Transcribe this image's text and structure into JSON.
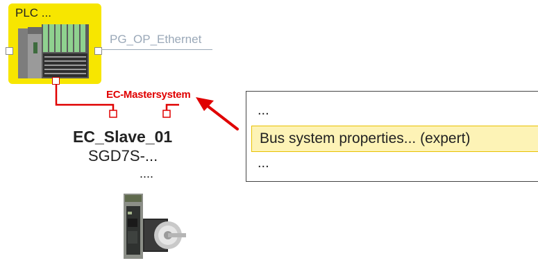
{
  "plc": {
    "title": "PLC ..."
  },
  "network": {
    "ethernet_label": "PG_OP_Ethernet",
    "bus_label": "EC-Mastersystem"
  },
  "slave": {
    "name": "EC_Slave_01",
    "type": "SGD7S-...",
    "more": "...."
  },
  "context_menu": {
    "items": [
      {
        "label": "..."
      },
      {
        "label": "Bus system properties... (expert)",
        "highlighted": true
      },
      {
        "label": "..."
      }
    ]
  },
  "colors": {
    "plc_background": "#f7e600",
    "bus_line": "#e00000",
    "ethernet_line": "#9aa8b8",
    "menu_highlight": "#fdf3b6",
    "menu_highlight_border": "#e8c100"
  },
  "icons": {
    "plc": "plc-module-icon",
    "drive": "servo-drive-icon",
    "pointer": "red-arrow-pointer"
  }
}
